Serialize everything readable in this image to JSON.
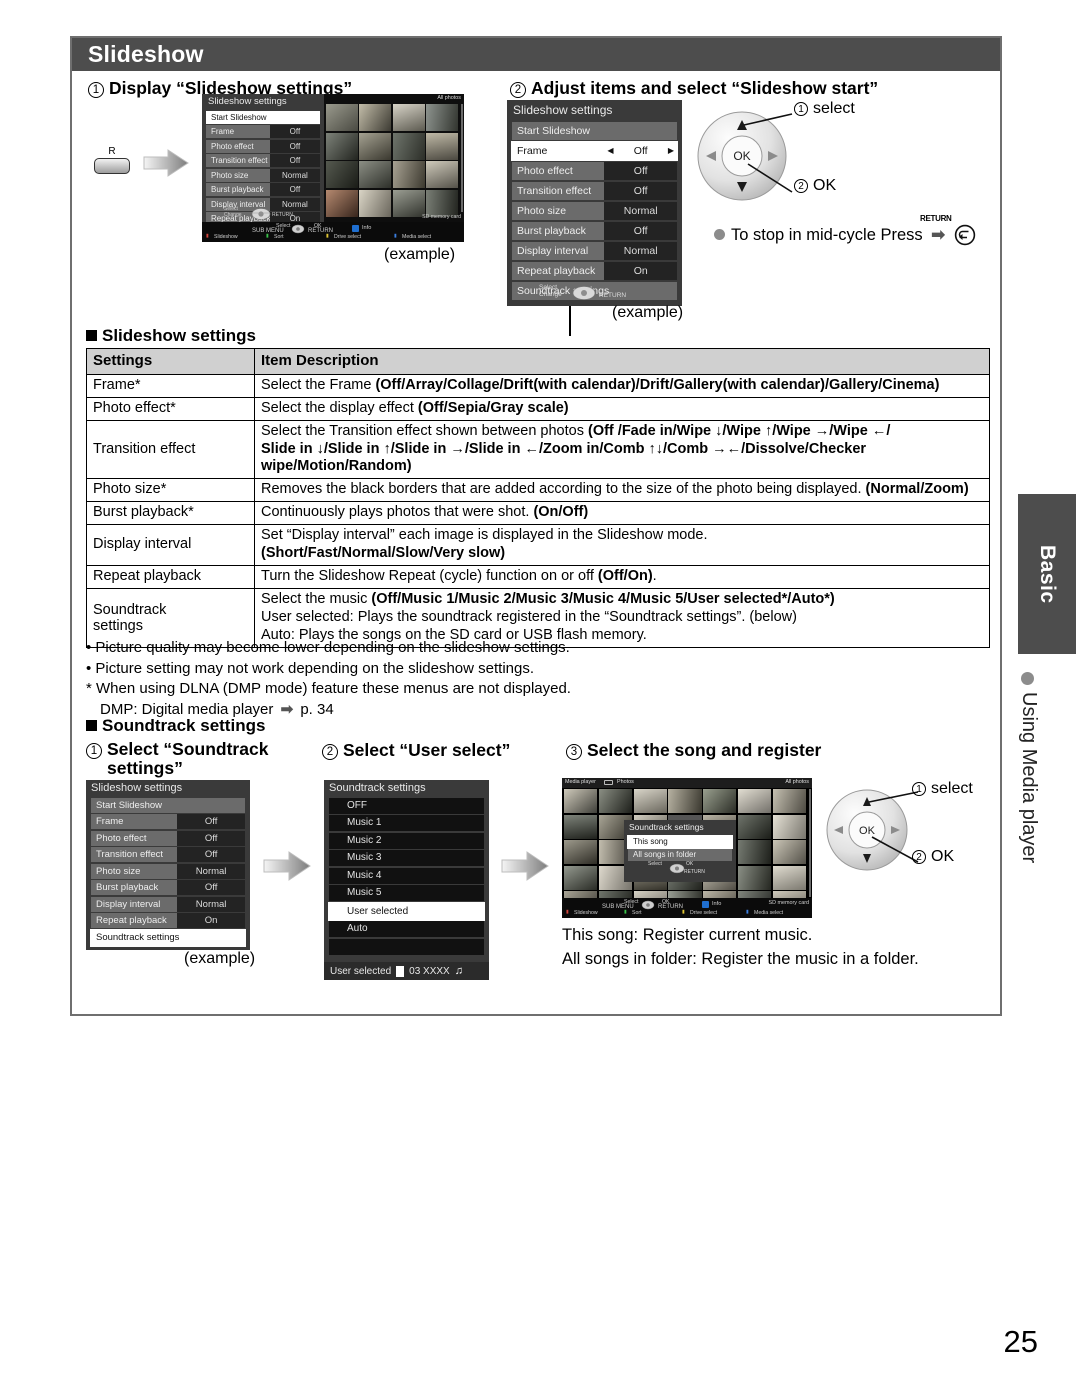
{
  "page": {
    "number": "25"
  },
  "header": {
    "title": "Slideshow"
  },
  "side": {
    "tab_label": "Basic",
    "section_label": "Using Media player"
  },
  "steps": {
    "step1": {
      "num": "1",
      "title": "Display “Slideshow settings”",
      "remote_key": "R",
      "example": "(example)"
    },
    "step2": {
      "num": "2",
      "title": "Adjust items and select “Slideshow start”",
      "example": "(example)",
      "dpad": {
        "select": "select",
        "select_num": "1",
        "ok": "OK",
        "ok_num": "2",
        "ok_center": "OK"
      },
      "stop_note": "To stop in mid-cycle Press",
      "return_label": "RETURN"
    }
  },
  "slideshow_menu": {
    "title": "Slideshow settings",
    "start": "Start Slideshow",
    "footer": "Soundtrack settings",
    "hint_select": "Select",
    "hint_change": "Change",
    "hint_return": "RETURN",
    "rows": [
      {
        "label": "Frame",
        "value": "Off"
      },
      {
        "label": "Photo effect",
        "value": "Off"
      },
      {
        "label": "Transition effect",
        "value": "Off"
      },
      {
        "label": "Photo size",
        "value": "Normal"
      },
      {
        "label": "Burst playback",
        "value": "Off"
      },
      {
        "label": "Display interval",
        "value": "Normal"
      },
      {
        "label": "Repeat playback",
        "value": "On"
      }
    ]
  },
  "photo_browser": {
    "title_right": "All photos",
    "title_left": "Media player",
    "title_left2": "Photos",
    "storage": "SD memory card",
    "bar": {
      "select": "Select",
      "ok": "OK",
      "sub_menu": "SUB MENU",
      "return": "RETURN",
      "info": "Info",
      "slideshow": "Slideshow",
      "sort": "Sort",
      "drive_select": "Drive select",
      "media_select": "Media select"
    }
  },
  "settings_section": {
    "heading": "Slideshow settings",
    "columns": [
      "Settings",
      "Item Description"
    ],
    "rows": [
      {
        "setting": "Frame*",
        "desc_plain": "Select the Frame ",
        "desc_bold": "(Off/Array/Collage/Drift(with calendar)/Drift/Gallery(with calendar)/Gallery/Cinema)"
      },
      {
        "setting": "Photo effect*",
        "desc_plain": "Select the display effect ",
        "desc_bold": "(Off/Sepia/Gray scale)"
      },
      {
        "setting": "Transition effect",
        "desc_line1_plain": "Select the Transition effect shown between photos ",
        "desc_line1_bold": "(Off /Fade in/Wipe ↓/Wipe ↑/Wipe →/Wipe ←/",
        "desc_line2_bold": "Slide in ↓/Slide in ↑/Slide in →/Slide in ←/Zoom in/Comb ↑↓/Comb →←/Dissolve/Checker",
        "desc_line3_bold": "wipe/Motion/Random)"
      },
      {
        "setting": "Photo size*",
        "desc_plain": "Removes the black borders that are added according to the size of the photo being displayed. ",
        "desc_bold": "(Normal/Zoom)"
      },
      {
        "setting": "Burst playback*",
        "desc_plain": "Continuously plays photos that were shot. ",
        "desc_bold": "(On/Off)"
      },
      {
        "setting": "Display interval",
        "desc_line1_plain": "Set “Display interval” each image is displayed in the Slideshow mode.",
        "desc_line2_bold": "(Short/Fast/Normal/Slow/Very slow)"
      },
      {
        "setting": "Repeat playback",
        "desc_plain": "Turn the Slideshow Repeat (cycle) function on or off ",
        "desc_bold": "(Off/On)",
        "desc_tail": "."
      },
      {
        "setting": "Soundtrack settings",
        "desc_line1_plain": "Select the music ",
        "desc_line1_bold": "(Off/Music 1/Music 2/Music 3/Music 4/Music 5/User selected*/Auto*)",
        "desc_line2_plain": "User selected: Plays the soundtrack registered in the “Soundtrack settings”. (below)",
        "desc_line3_plain": "Auto: Plays the songs on the SD card or USB flash memory."
      }
    ]
  },
  "notes": {
    "line1": "• Picture quality may become lower depending on the slideshow settings.",
    "line2": "• Picture setting may not work depending on the slideshow settings.",
    "line3": "* When using DLNA (DMP mode) feature these menus are not displayed.",
    "line4_pre": "DMP: Digital media player",
    "line4_page": "p. 34"
  },
  "soundtrack_section": {
    "heading": "Soundtrack settings",
    "step1": {
      "num": "1",
      "title_l1": "Select “Soundtrack",
      "title_l2": "settings”",
      "example": "(example)"
    },
    "step2": {
      "num": "2",
      "title": "Select “User select”"
    },
    "step3": {
      "num": "3",
      "title": "Select the song and register",
      "dpad": {
        "select": "select",
        "select_num": "1",
        "ok": "OK",
        "ok_num": "2",
        "ok_center": "OK"
      },
      "caption1": "This song: Register current music.",
      "caption2": "All songs in folder: Register the music in a folder."
    },
    "soundtrack_menu": {
      "title": "Soundtrack settings",
      "items": [
        "OFF",
        "Music 1",
        "Music 2",
        "Music 3",
        "Music 4",
        "Music 5",
        "User selected",
        "Auto"
      ],
      "selected": "User selected",
      "footer_label": "User selected",
      "footer_track": "03 XXXX"
    },
    "overlay_menu": {
      "title": "Soundtrack settings",
      "item1": "This song",
      "item2": "All songs in folder",
      "hint_select": "Select",
      "hint_ok": "OK",
      "hint_return": "RETURN"
    }
  }
}
